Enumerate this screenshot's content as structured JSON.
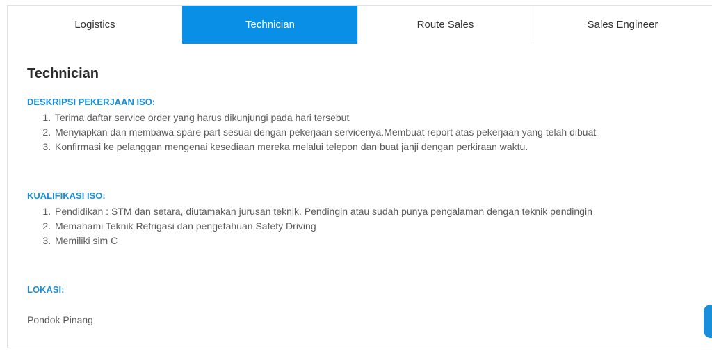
{
  "tabs": [
    {
      "label": "Logistics",
      "active": false
    },
    {
      "label": "Technician",
      "active": true
    },
    {
      "label": "Route Sales",
      "active": false
    },
    {
      "label": "Sales Engineer",
      "active": false
    }
  ],
  "job": {
    "title": "Technician",
    "description_heading": "DESKRIPSI PEKERJAAN ISO:",
    "description": [
      "Terima daftar service order yang harus dikunjungi pada hari tersebut",
      "Menyiapkan dan membawa spare part sesuai dengan pekerjaan servicenya.Membuat report atas pekerjaan yang telah dibuat",
      "Konfirmasi ke pelanggan mengenai kesediaan mereka melalui telepon dan buat janji dengan perkiraan waktu."
    ],
    "qualification_heading": "KUALIFIKASI ISO:",
    "qualifications": [
      "Pendidikan :   STM dan setara, diutamakan jurusan teknik. Pendingin atau sudah punya pengalaman dengan teknik pendingin",
      "Memahami Teknik Refrigasi dan pengetahuan Safety Driving",
      "Memiliki sim C"
    ],
    "location_heading": "LOKASI:",
    "location": "Pondok Pinang"
  },
  "colors": {
    "accent": "#0a8fe6",
    "heading_blue": "#1a8fd9"
  },
  "icons": {
    "floating_button": "chat-launcher-icon"
  }
}
